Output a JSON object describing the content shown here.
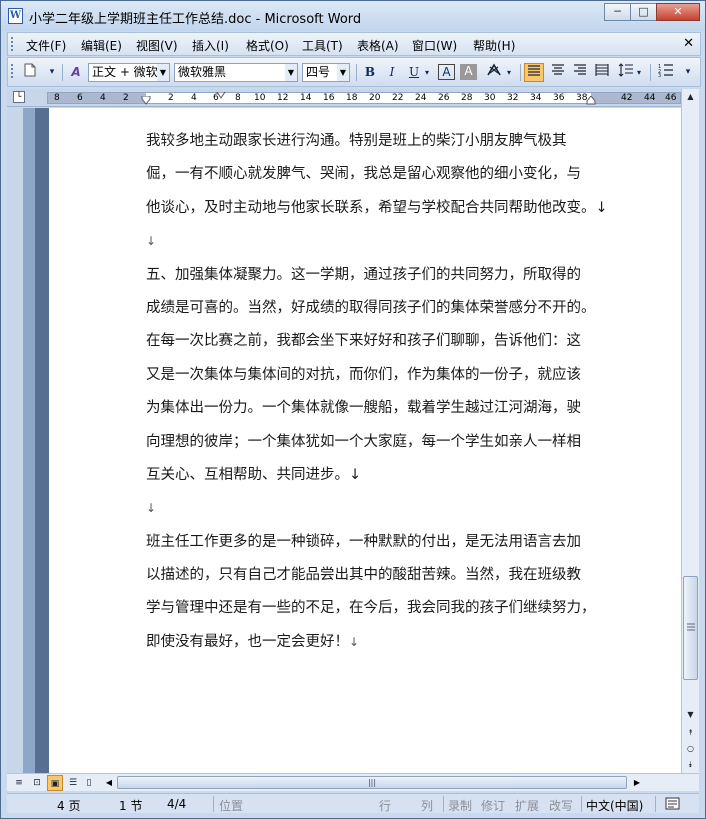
{
  "window": {
    "title": "小学二年级上学期班主任工作总结.doc - Microsoft Word",
    "app_icon_letter": "W",
    "buttons": {
      "minimize": "─",
      "restore": "□",
      "close": "✕"
    }
  },
  "menubar": {
    "items": [
      "文件(F)",
      "编辑(E)",
      "视图(V)",
      "插入(I)",
      "格式(O)",
      "工具(T)",
      "表格(A)",
      "窗口(W)",
      "帮助(H)"
    ],
    "close_doc": "✕"
  },
  "toolbar": {
    "style_value": "正文 + 微软",
    "font_value": "微软雅黑",
    "size_value": "四号",
    "bold": "B",
    "italic": "I",
    "underline": "U",
    "border_char": "A",
    "shade_char": "A",
    "style_icon_label": "A"
  },
  "ruler": {
    "numbers": [
      "8",
      "6",
      "4",
      "2",
      "2",
      "4",
      "6",
      "8",
      "10",
      "12",
      "14",
      "16",
      "18",
      "20",
      "22",
      "24",
      "26",
      "28",
      "30",
      "32",
      "34",
      "36",
      "38",
      "42",
      "44",
      "46"
    ]
  },
  "document": {
    "lines": [
      "我较多地主动跟家长进行沟通。特别是班上的柴汀小朋友脾气极其",
      "倔，一有不顺心就发脾气、哭闹，我总是留心观察他的细小变化，与",
      "他谈心，及时主动地与他家长联系，希望与学校配合共同帮助他改变。↓",
      "↓",
      "五、加强集体凝聚力。这一学期，通过孩子们的共同努力，所取得的",
      "成绩是可喜的。当然，好成绩的取得同孩子们的集体荣誉感分不开的。",
      "在每一次比赛之前，我都会坐下来好好和孩子们聊聊，告诉他们：这",
      "又是一次集体与集体间的对抗，而你们，作为集体的一份子，就应该",
      "为集体出一份力。一个集体就像一艘船，载着学生越过江河湖海，驶",
      "向理想的彼岸；一个集体犹如一个大家庭，每一个学生如亲人一样相",
      "互关心、互相帮助、共同进步。↓",
      "↓",
      "班主任工作更多的是一种锁碎，一种默默的付出，是无法用语言去加",
      "以描述的，只有自己才能品尝出其中的酸甜苦辣。当然，我在班级教",
      "学与管理中还是有一些的不足，在今后，我会同我的孩子们继续努力，",
      "即使没有最好，也一定会更好！"
    ],
    "end_mark": "↓"
  },
  "statusbar": {
    "page": "4 页",
    "section": "1 节",
    "page_of": "4/4",
    "position": "位置",
    "line": "行",
    "column": "列",
    "rec": "录制",
    "trk": "修订",
    "ext": "扩展",
    "ovr": "改写",
    "language": "中文(中国)"
  }
}
